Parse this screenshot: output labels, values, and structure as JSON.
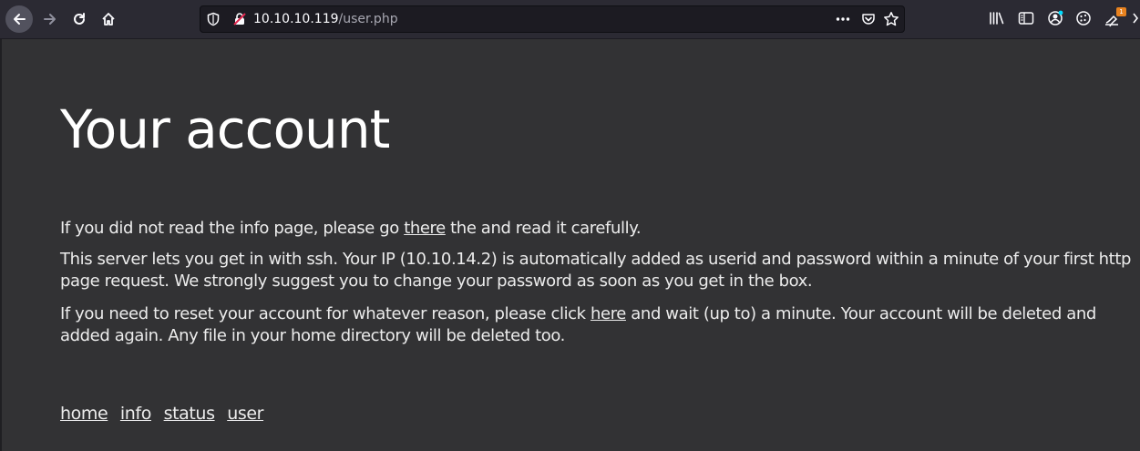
{
  "browser": {
    "url_host": "10.10.10.119",
    "url_path": "/user.php",
    "extension_badge": "1",
    "icons": {
      "back": "back-arrow-icon",
      "forward": "forward-arrow-icon",
      "reload": "reload-icon",
      "home": "home-icon",
      "shield": "tracking-protection-shield-icon",
      "lock": "insecure-lock-icon",
      "more": "more-dots-icon",
      "pocket": "pocket-icon",
      "star": "bookmark-star-icon",
      "library": "library-icon",
      "sidebar": "sidebar-icon",
      "account": "account-icon",
      "cookie": "cookie-icon",
      "extension": "extension-icon",
      "overflow": "overflow-menu-icon"
    }
  },
  "page": {
    "title": "Your account",
    "p1_before": "If you did not read the info page, please go ",
    "p1_link": "there",
    "p1_after": " the and read it carefully.",
    "p2": "This server lets you get in with ssh. Your IP (10.10.14.2) is automatically added as userid and password within a minute of your first http page request. We strongly suggest you to change your password as soon as you get in the box.",
    "p3_before": "If you need to reset your account for whatever reason, please click ",
    "p3_link": "here",
    "p3_after": " and wait (up to) a minute. Your account will be deleted and added again. Any file in your home directory will be deleted too.",
    "nav": [
      "home",
      "info",
      "status",
      "user"
    ]
  },
  "colors": {
    "page_background": "#323234",
    "toolbar_background": "#2b2a33",
    "text": "#ececec"
  }
}
